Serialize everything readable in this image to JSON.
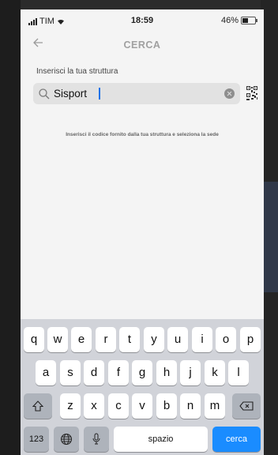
{
  "status_bar": {
    "carrier": "TIM",
    "time": "18:59",
    "battery": "46%"
  },
  "nav": {
    "title": "CERCA"
  },
  "form": {
    "label": "Inserisci la tua struttura",
    "search_value": "Sisport",
    "hint": "Inserisci il codice fornito dalla tua struttura e seleziona la sede"
  },
  "keyboard": {
    "row1": [
      "q",
      "w",
      "e",
      "r",
      "t",
      "y",
      "u",
      "i",
      "o",
      "p"
    ],
    "row2": [
      "a",
      "s",
      "d",
      "f",
      "g",
      "h",
      "j",
      "k",
      "l"
    ],
    "row3": [
      "z",
      "x",
      "c",
      "v",
      "b",
      "n",
      "m"
    ],
    "numbers_key": "123",
    "space_key": "spazio",
    "action_key": "cerca"
  },
  "colors": {
    "accent": "#1a8cff",
    "background": "#f4f4f4",
    "keyboard_bg": "#d1d3d9"
  }
}
